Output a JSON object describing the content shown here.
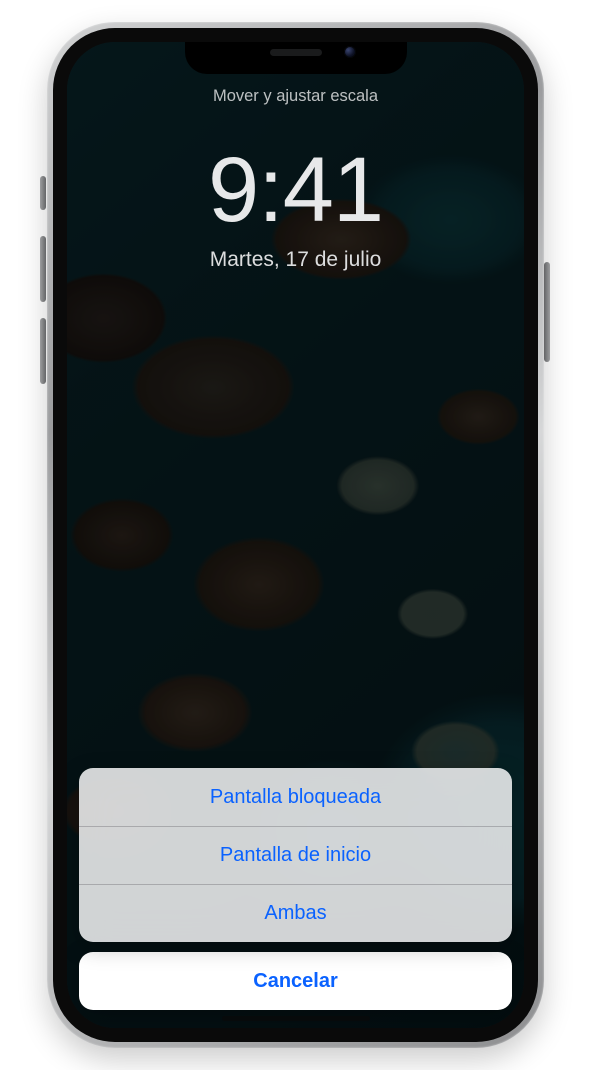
{
  "header_title": "Mover y ajustar escala",
  "clock": "9:41",
  "date": "Martes, 17 de julio",
  "action_sheet": {
    "options": [
      "Pantalla bloqueada",
      "Pantalla de inicio",
      "Ambas"
    ],
    "cancel": "Cancelar"
  },
  "colors": {
    "ios_blue": "#0a62ff",
    "lock_text": "#e7e8e9",
    "sheet_bg": "rgba(238,239,240,.88)"
  }
}
